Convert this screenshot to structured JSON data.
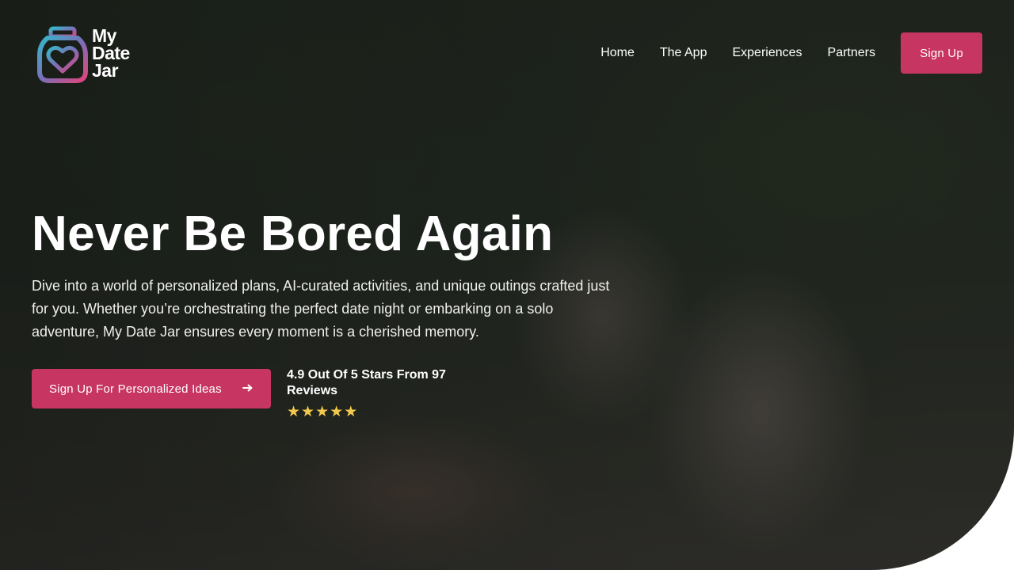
{
  "brand": {
    "name_line1": "My",
    "name_line2": "Date",
    "name_line3": "Jar",
    "logo_icon": "heart-jar-icon",
    "accent_color": "#c73563"
  },
  "nav": {
    "links": [
      {
        "label": "Home"
      },
      {
        "label": "The App"
      },
      {
        "label": "Experiences"
      },
      {
        "label": "Partners"
      }
    ],
    "cta_label": "Sign Up"
  },
  "hero": {
    "headline": "Never Be Bored Again",
    "subcopy": "Dive into a world of personalized plans, AI-curated activities, and unique outings crafted just for you. Whether you’re orchestrating the perfect date night or embarking on a solo adventure, My Date Jar ensures every moment is a cherished memory.",
    "cta_label": "Sign Up For Personalized Ideas",
    "cta_icon": "arrow-right-icon",
    "rating_text": "4.9 Out Of 5 Stars From 97 Reviews",
    "stars": 5,
    "star_color": "#f2c94c"
  }
}
